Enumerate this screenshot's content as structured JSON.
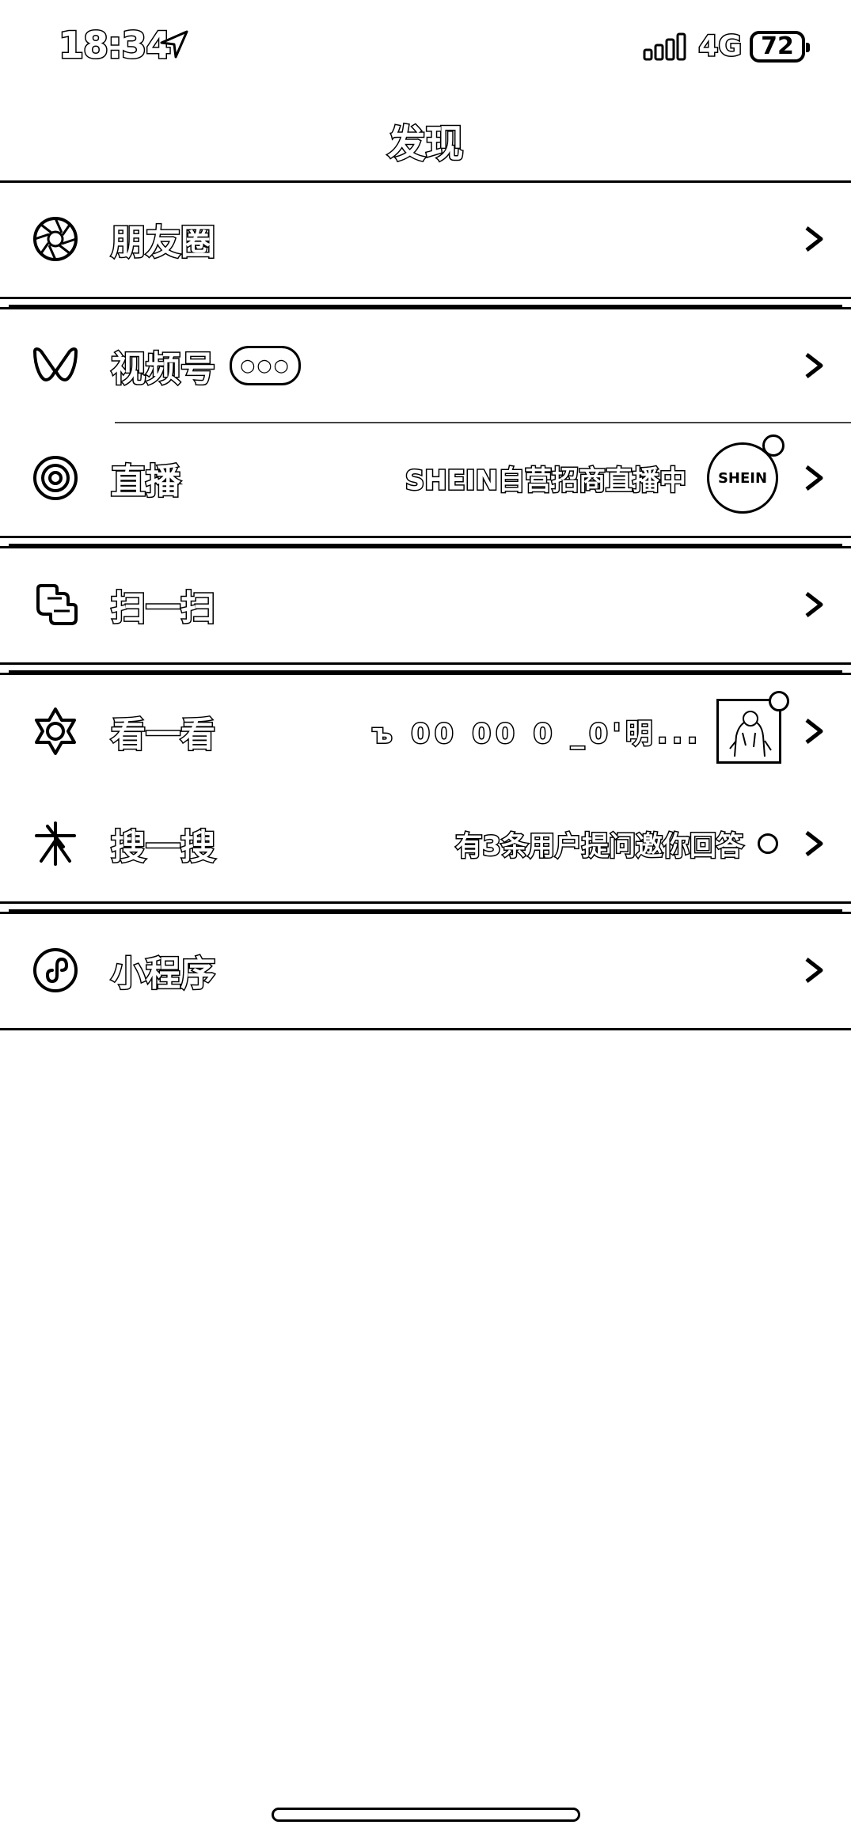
{
  "status_bar": {
    "time": "18:34",
    "network": "4G",
    "battery": "72"
  },
  "header": {
    "title": "发现"
  },
  "menu": {
    "moments": {
      "label": "朋友圈"
    },
    "channels": {
      "label": "视频号",
      "badge": "○○○"
    },
    "live": {
      "label": "直播",
      "subtitle": "SHEIN自营招商直播中",
      "avatar_text": "SHEIN"
    },
    "scan": {
      "label": "扫一扫"
    },
    "top_stories": {
      "label": "看一看",
      "subtitle": "ъ 00 00 0 _0'明..."
    },
    "search": {
      "label": "搜一搜",
      "subtitle": "有3条用户提问邀你回答"
    },
    "mini_programs": {
      "label": "小程序"
    }
  },
  "icons": {
    "moments": "aperture-icon",
    "channels": "butterfly-icon",
    "live": "concentric-circle-icon",
    "scan": "scan-icon",
    "top_stories": "flower-icon",
    "search": "star-search-icon",
    "mini_programs": "mini-program-icon",
    "chevron": "chevron-right-icon"
  }
}
